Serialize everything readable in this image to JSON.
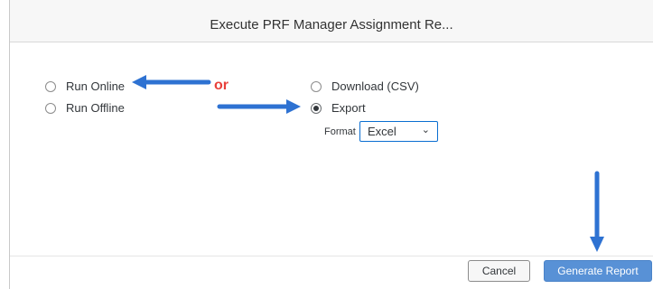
{
  "dialog": {
    "title": "Execute PRF Manager Assignment Re..."
  },
  "run_mode": {
    "options": [
      {
        "label": "Run Online",
        "selected": false
      },
      {
        "label": "Run Offline",
        "selected": false
      }
    ]
  },
  "output": {
    "options": [
      {
        "label": "Download (CSV)",
        "selected": false
      },
      {
        "label": "Export",
        "selected": true
      }
    ],
    "format_label": "Format",
    "format_value": "Excel"
  },
  "annotation": {
    "or_text": "or",
    "or_color": "#e8403a",
    "arrow_color": "#2e72d2"
  },
  "footer": {
    "cancel_label": "Cancel",
    "generate_label": "Generate Report"
  },
  "icons": {
    "chevron": "chevron-down-icon",
    "arrow": "arrow-icon"
  }
}
